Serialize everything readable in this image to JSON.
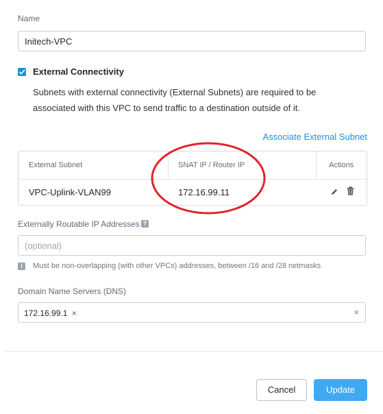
{
  "name_field": {
    "label": "Name",
    "value": "Initech-VPC"
  },
  "external_connectivity": {
    "checkbox_label": "External Connectivity",
    "checked": true,
    "description_line1": "Subnets with external connectivity (External Subnets) are required to be",
    "description_line2": "associated with this VPC to send traffic to a destination outside of it.",
    "associate_link": "Associate External Subnet"
  },
  "subnet_table": {
    "columns": [
      "External Subnet",
      "SNAT IP / Router IP",
      "Actions"
    ],
    "rows": [
      {
        "external_subnet": "VPC-Uplink-VLAN99",
        "snat_ip": "172.16.99.11",
        "actions": [
          "edit-icon",
          "trash-icon"
        ]
      }
    ]
  },
  "routable_ips": {
    "label": "Externally Routable IP Addresses",
    "help_icon": "?",
    "placeholder": "(optional)",
    "value": "",
    "hint": "Must be non-overlapping (with other VPCs) addresses, between /16 and /28 netmasks",
    "hint_icon": "i"
  },
  "dns": {
    "label": "Domain Name Servers (DNS)",
    "tags": [
      "172.16.99.1"
    ],
    "tag_remove": "×",
    "clear_all": "×"
  },
  "footer": {
    "cancel_label": "Cancel",
    "update_label": "Update"
  },
  "colors": {
    "accent": "#1b8fdc",
    "primary_button": "#40a9f4",
    "annotation_circle": "#e0242a"
  }
}
